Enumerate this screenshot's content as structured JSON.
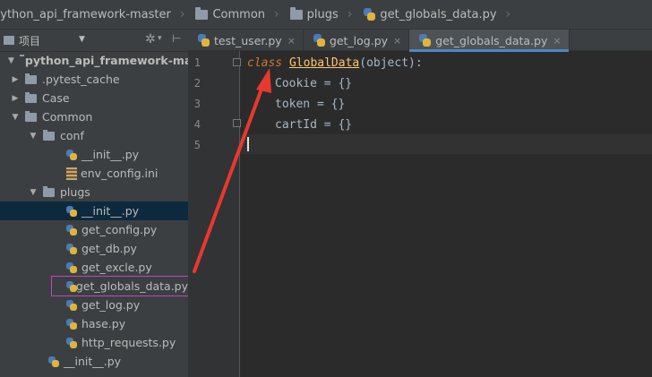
{
  "breadcrumb": {
    "items": [
      {
        "label": "python_api_framework-master",
        "icon": "project-folder-icon"
      },
      {
        "label": "Common",
        "icon": "folder-icon"
      },
      {
        "label": "plugs",
        "icon": "folder-icon"
      },
      {
        "label": "get_globals_data.py",
        "icon": "python-file-icon"
      }
    ]
  },
  "project_panel": {
    "title": "项目",
    "tree": [
      {
        "label": "python_api_framework-master",
        "level": 0,
        "expanded": true,
        "type": "folder",
        "bold": true
      },
      {
        "label": ".pytest_cache",
        "level": 1,
        "expanded": false,
        "type": "folder"
      },
      {
        "label": "Case",
        "level": 1,
        "expanded": false,
        "type": "folder"
      },
      {
        "label": "Common",
        "level": 1,
        "expanded": true,
        "type": "folder"
      },
      {
        "label": "conf",
        "level": 2,
        "expanded": true,
        "type": "folder"
      },
      {
        "label": "__init__.py",
        "level": 3,
        "type": "python"
      },
      {
        "label": "env_config.ini",
        "level": 3,
        "type": "ini"
      },
      {
        "label": "plugs",
        "level": 2,
        "expanded": true,
        "type": "folder"
      },
      {
        "label": "__init__.py",
        "level": 3,
        "type": "python",
        "selected": true
      },
      {
        "label": "get_config.py",
        "level": 3,
        "type": "python"
      },
      {
        "label": "get_db.py",
        "level": 3,
        "type": "python"
      },
      {
        "label": "get_excle.py",
        "level": 3,
        "type": "python"
      },
      {
        "label": "get_globals_data.py",
        "level": 3,
        "type": "python",
        "highlighted": true
      },
      {
        "label": "get_log.py",
        "level": 3,
        "type": "python"
      },
      {
        "label": "hase.py",
        "level": 3,
        "type": "python"
      },
      {
        "label": "http_requests.py",
        "level": 3,
        "type": "python"
      },
      {
        "label": "__init__.py",
        "level": 2,
        "type": "python"
      }
    ]
  },
  "tabs": [
    {
      "label": "test_user.py",
      "active": false
    },
    {
      "label": "get_log.py",
      "active": false
    },
    {
      "label": "get_globals_data.py",
      "active": true
    }
  ],
  "editor": {
    "line_numbers": [
      "1",
      "2",
      "3",
      "4",
      "5"
    ],
    "lines": {
      "l1_kw": "class",
      "l1_name": "GlobalData",
      "l1_rest": "(object):",
      "l2": "Cookie = {}",
      "l3": "token = {}",
      "l4": "cartId = {}"
    }
  },
  "colors": {
    "annotation_box": "#c542c5",
    "annotation_arrow": "#e8382f",
    "tab_accent": "#4a88c7"
  }
}
